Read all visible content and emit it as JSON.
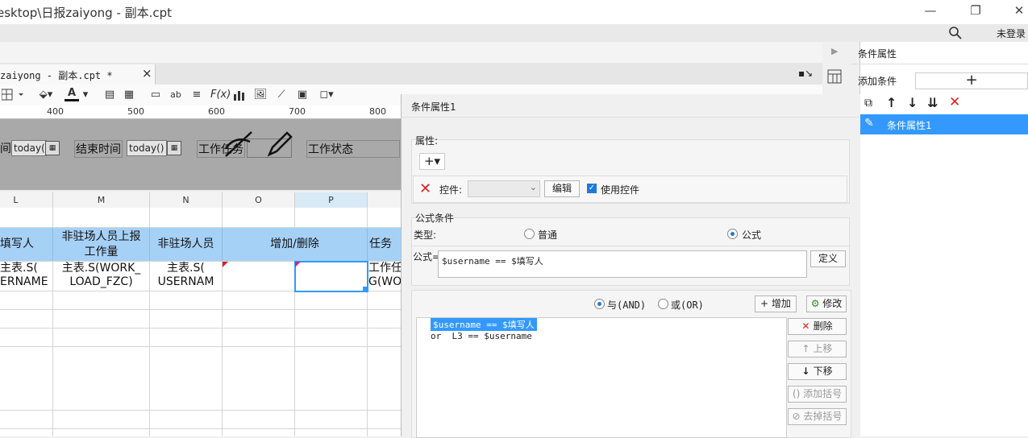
{
  "window": {
    "title": "esktop\\日报zaiyong - 副本.cpt",
    "min": "—",
    "restore": "❐",
    "close": "✕"
  },
  "topbar": {
    "login_label": "未登录"
  },
  "editor": {
    "tab_label": "zaiyong - 副本.cpt *",
    "tab_close": "×",
    "font_color_glyph": "A",
    "ruler": [
      "400",
      "500",
      "600",
      "700",
      "800"
    ],
    "params": {
      "start_input": "today(",
      "end_label": "结束时间",
      "end_input": "today()",
      "work_label": "工作任务",
      "status_label": "工作状态",
      "cal": "▦"
    },
    "columns": [
      "L",
      "M",
      "N",
      "O",
      "P"
    ],
    "header_cells": [
      "填写人",
      "非驻场人员上报\n工作量",
      "非驻场人员",
      "增加/删除",
      "任务"
    ],
    "data_cells": [
      "主表.S(\nERNAME",
      "主表.S(WORK_\nLOAD_FZC)",
      "主表.S(\nUSERNAM",
      "",
      "",
      "工作任\nG(WOR"
    ]
  },
  "dialog": {
    "title": "条件属性1",
    "attr_label": "属性:",
    "add_glyph": "+▾",
    "control_label": "控件:",
    "edit_button": "编辑",
    "use_control_label": "使用控件",
    "formula_cond_label": "公式条件",
    "type_label": "类型:",
    "type_options": {
      "normal": "普通",
      "formula": "公式"
    },
    "formula_label": "公式=",
    "formula_value": "$username == $填写人",
    "define_button": "定义",
    "and_label": "与(AND)",
    "or_label": "或(OR)",
    "add_button": "增加",
    "modify_button": "修改",
    "conditions": [
      "$username == $填写人",
      "or  L3 == $username"
    ],
    "delete_button": "删除",
    "up_button": "上移",
    "down_button": "下移",
    "add_bracket_button": "添加括号",
    "remove_bracket_button": "去掉括号"
  },
  "right_panel": {
    "title": "条件属性",
    "add_condition_label": "添加条件",
    "add_glyph": "+",
    "items": [
      "条件属性1"
    ]
  },
  "colors": {
    "header_blue": "#a6d1f7",
    "selection": "#3399ff",
    "delete_red": "#e02020"
  }
}
